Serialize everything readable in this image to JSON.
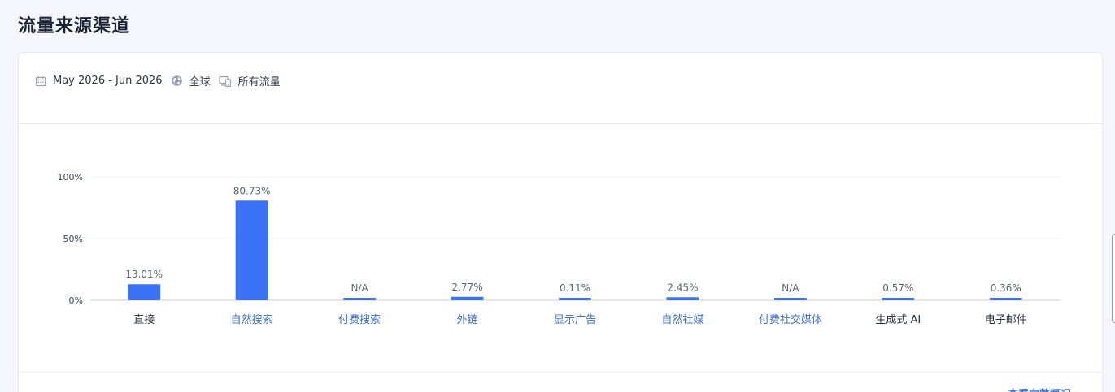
{
  "page": {
    "title": "流量来源渠道"
  },
  "filters": {
    "date_range": "May 2026 - Jun 2026",
    "region": "全球",
    "traffic": "所有流量"
  },
  "footer": {
    "link": "查看完整概况"
  },
  "colors": {
    "bar": "#3b73f7",
    "link": "#3a6fd8",
    "plain": "#2b3445"
  },
  "chart_data": {
    "type": "bar",
    "categories": [
      "直接",
      "自然搜索",
      "付费搜索",
      "外链",
      "显示广告",
      "自然社媒",
      "付费社交媒体",
      "生成式 AI",
      "电子邮件"
    ],
    "values": [
      13.01,
      80.73,
      null,
      2.77,
      0.11,
      2.45,
      null,
      0.57,
      0.36
    ],
    "data_labels": [
      "13.01%",
      "80.73%",
      "N/A",
      "2.77%",
      "0.11%",
      "2.45%",
      "N/A",
      "0.57%",
      "0.36%"
    ],
    "category_linked": [
      false,
      true,
      true,
      true,
      true,
      true,
      true,
      false,
      false
    ],
    "y_ticks": [
      {
        "value": 0,
        "label": "0%"
      },
      {
        "value": 50,
        "label": "50%"
      },
      {
        "value": 100,
        "label": "100%"
      }
    ],
    "ylim": [
      0,
      100
    ],
    "grid": true
  }
}
